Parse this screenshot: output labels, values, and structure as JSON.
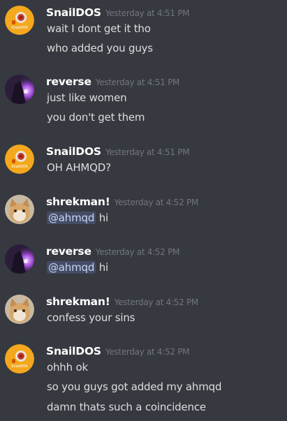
{
  "messages": [
    {
      "author": "SnailDOS",
      "time": "Yesterday at 4:51 PM",
      "avatar_text": "SnailDOS",
      "lines": [
        "wait I dont get it tho",
        "who added you guys"
      ]
    },
    {
      "author": "reverse",
      "time": "Yesterday at 4:51 PM",
      "lines": [
        "just like women",
        "you don't get them"
      ]
    },
    {
      "author": "SnailDOS",
      "time": "Yesterday at 4:51 PM",
      "avatar_text": "SnailDOS",
      "lines": [
        "OH AHMQD?"
      ]
    },
    {
      "author": "shrekman!",
      "time": "Yesterday at 4:52 PM",
      "mention": "@ahmqd",
      "lines": [
        "hi"
      ]
    },
    {
      "author": "reverse",
      "time": "Yesterday at 4:52 PM",
      "mention": "@ahmqd",
      "lines": [
        "hi"
      ]
    },
    {
      "author": "shrekman!",
      "time": "Yesterday at 4:52 PM",
      "lines": [
        "confess your sins"
      ]
    },
    {
      "author": "SnailDOS",
      "time": "Yesterday at 4:52 PM",
      "avatar_text": "SnailDOS",
      "lines": [
        "ohhh ok",
        "so you guys got added my ahmqd",
        "damn thats such a coincidence"
      ]
    }
  ]
}
